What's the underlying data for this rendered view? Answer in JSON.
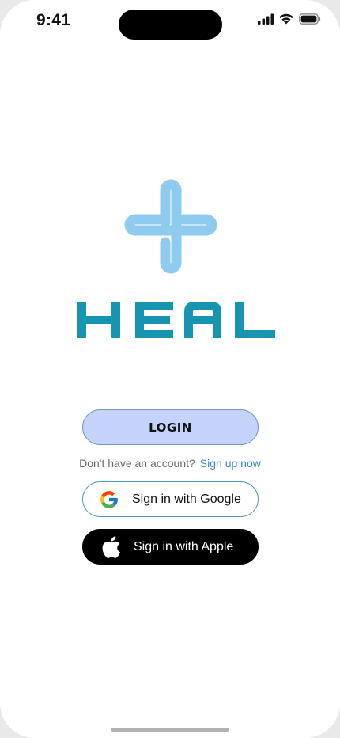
{
  "status_bar": {
    "time": "9:41",
    "icons": [
      "cellular-signal-icon",
      "wifi-icon",
      "battery-icon"
    ]
  },
  "brand": {
    "name": "HEAL",
    "logo_icon": "medical-cross-icon",
    "logo_color": "#8ecbef",
    "wordmark_color": "#1694b0"
  },
  "login": {
    "label": "LOGIN",
    "background": "#c5d3fb"
  },
  "signup": {
    "prompt": "Don't have an account?",
    "link": "Sign up now"
  },
  "social": {
    "google_label": "Sign in with Google",
    "google_icon": "google-icon",
    "apple_label": "Sign in with Apple",
    "apple_icon": "apple-icon"
  }
}
